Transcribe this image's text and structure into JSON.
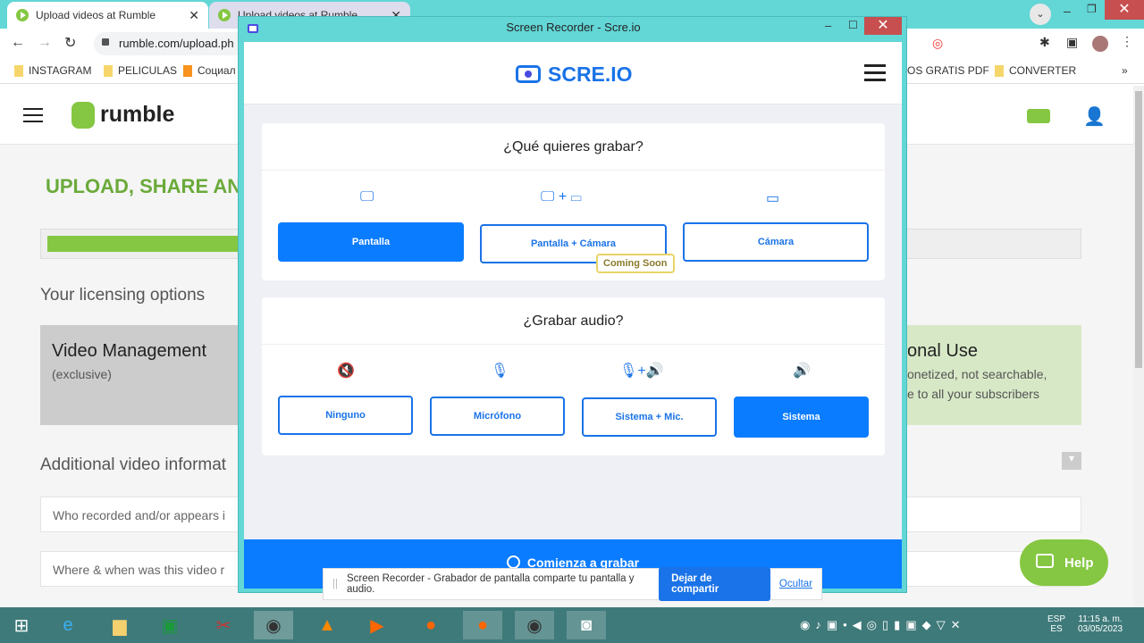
{
  "browser": {
    "tabs": [
      {
        "title": "Upload videos at Rumble"
      },
      {
        "title": "Upload videos at Rumble"
      }
    ],
    "url": "rumble.com/upload.ph",
    "bookmarks": [
      "INSTAGRAM",
      "PELICULAS",
      "Социал",
      "OS GRATIS PDF",
      "CONVERTER"
    ],
    "more": "»"
  },
  "rumble": {
    "logo": "rumble",
    "heading": "UPLOAD, SHARE AN",
    "licensing": "Your licensing options",
    "vm_title": "Video Management",
    "vm_sub": "(exclusive)",
    "personal_title": "onal Use",
    "personal_l1": "onetized, not searchable,",
    "personal_l2": "e to all your subscribers",
    "additional": "Additional video informat",
    "field1": "Who recorded and/or appears i",
    "field2": "Where & when was this video r",
    "help": "Help",
    "progress_percent": 19
  },
  "popup": {
    "title": "Screen Recorder - Scre.io",
    "logo": "SCRE.IO",
    "q1": "¿Qué quieres grabar?",
    "video_options": [
      {
        "label": "Pantalla",
        "selected": true
      },
      {
        "label": "Pantalla + Cámara",
        "selected": false
      },
      {
        "label": "Cámara",
        "selected": false
      }
    ],
    "coming_soon": "Coming Soon",
    "q2": "¿Grabar audio?",
    "audio_options": [
      {
        "label": "Ninguno",
        "selected": false
      },
      {
        "label": "Micrófono",
        "selected": false
      },
      {
        "label": "Sistema + Mic.",
        "selected": false
      },
      {
        "label": "Sistema",
        "selected": true
      }
    ],
    "start": "Comienza a grabar"
  },
  "sharebar": {
    "text": "Screen Recorder - Grabador de pantalla comparte tu pantalla y audio.",
    "stop": "Dejar de compartir",
    "hide": "Ocultar"
  },
  "taskbar": {
    "lang1": "ESP",
    "lang2": "ES",
    "time": "11:15 a. m.",
    "date": "03/05/2023"
  },
  "colors": {
    "accent": "#0a7cff",
    "rumble_green": "#85c742",
    "teal": "#63d6d6"
  }
}
